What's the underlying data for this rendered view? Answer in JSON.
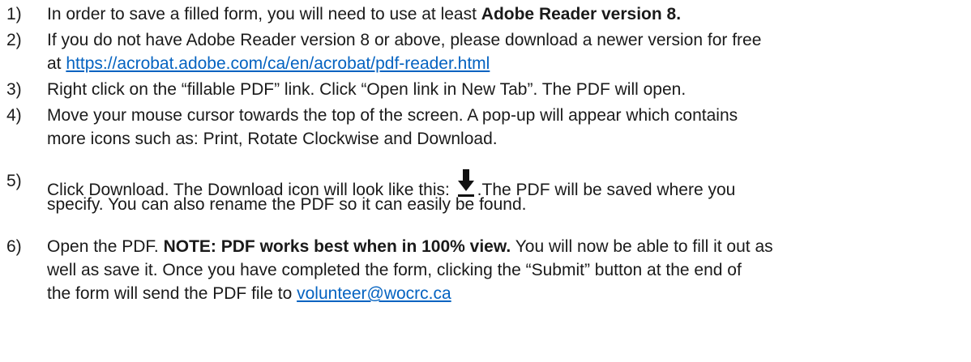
{
  "instructions": [
    {
      "number": "1)",
      "parts": {
        "a": "In order to save a filled form, you will need to use at least ",
        "b_bold": "Adobe Reader version 8."
      }
    },
    {
      "number": "2)",
      "parts": {
        "a": "If you do not have Adobe Reader version 8 or above, please download a newer version for free",
        "b": "at ",
        "link": "https://acrobat.adobe.com/ca/en/acrobat/pdf-reader.html"
      }
    },
    {
      "number": "3)",
      "parts": {
        "a": "Right click on the “fillable PDF” link. Click “Open link in New Tab”. The PDF will open."
      }
    },
    {
      "number": "4)",
      "parts": {
        "a": "Move your mouse cursor towards the top of the screen. A pop-up will appear which contains",
        "b": "more icons such as: Print, Rotate Clockwise and Download."
      }
    },
    {
      "number": "5)",
      "parts": {
        "a": "Click Download. The Download icon will look like this: ",
        "icon": "download-icon",
        "b": ".The PDF will be saved where you",
        "c": "specify. You can also rename the PDF so it can easily be found."
      }
    },
    {
      "number": "6)",
      "parts": {
        "a": "Open the PDF. ",
        "b_bold": "NOTE: PDF works best when in 100% view.",
        "c": " You will now be able to fill it out as",
        "d": "well as save it. Once you have completed the form, clicking the “Submit” button at the end of",
        "e": "the form will send the PDF file to ",
        "email": "volunteer@wocrc.ca"
      }
    }
  ],
  "colors": {
    "link": "#0563c1",
    "text": "#1a1a1a"
  }
}
